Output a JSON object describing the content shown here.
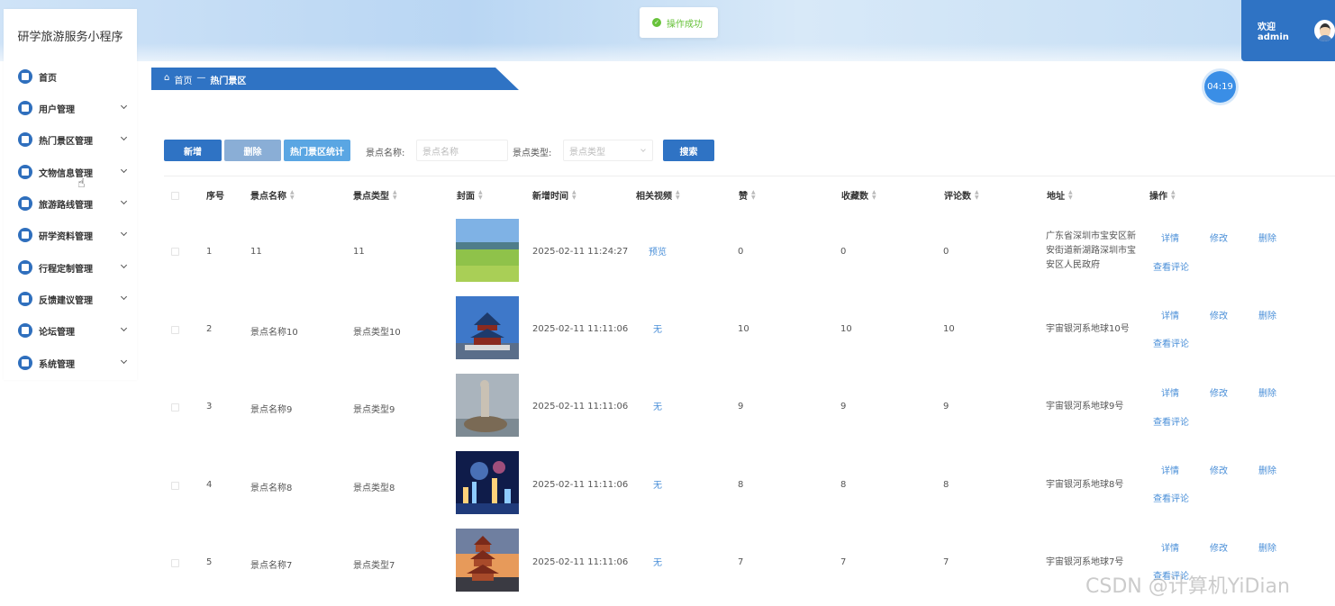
{
  "app": {
    "title": "研学旅游服务小程序"
  },
  "toast": {
    "message": "操作成功"
  },
  "user": {
    "welcome": "欢迎 admin"
  },
  "sidebar": {
    "items": [
      {
        "label": "首页",
        "icon": "home-icon"
      },
      {
        "label": "用户管理",
        "icon": "user-icon"
      },
      {
        "label": "热门景区管理",
        "icon": "square-icon"
      },
      {
        "label": "文物信息管理",
        "icon": "square-icon"
      },
      {
        "label": "旅游路线管理",
        "icon": "square-icon"
      },
      {
        "label": "研学资料管理",
        "icon": "gear-icon"
      },
      {
        "label": "行程定制管理",
        "icon": "square-icon"
      },
      {
        "label": "反馈建议管理",
        "icon": "folder-icon"
      },
      {
        "label": "论坛管理",
        "icon": "square-icon"
      },
      {
        "label": "系统管理",
        "icon": "square-icon"
      }
    ]
  },
  "breadcrumb": {
    "home": "首页",
    "separator": "—",
    "current": "热门景区"
  },
  "timer": "04:19",
  "toolbar": {
    "add": "新增",
    "delete": "删除",
    "stats": "热门景区统计",
    "name_label": "景点名称:",
    "name_placeholder": "景点名称",
    "type_label": "景点类型:",
    "type_placeholder": "景点类型",
    "search": "搜索"
  },
  "table": {
    "headers": [
      "序号",
      "景点名称",
      "景点类型",
      "封面",
      "新增时间",
      "相关视频",
      "赞",
      "收藏数",
      "评论数",
      "地址",
      "操作"
    ],
    "rows": [
      {
        "index": "1",
        "name": "11",
        "type": "11",
        "time": "2025-02-11 11:24:27",
        "video": "预览",
        "likes": "0",
        "favorites": "0",
        "comments": "0",
        "address": "广东省深圳市宝安区新安街道新湖路深圳市宝安区人民政府"
      },
      {
        "index": "2",
        "name": "景点名称10",
        "type": "景点类型10",
        "time": "2025-02-11 11:11:06",
        "video": "无",
        "likes": "10",
        "favorites": "10",
        "comments": "10",
        "address": "宇宙银河系地球10号"
      },
      {
        "index": "3",
        "name": "景点名称9",
        "type": "景点类型9",
        "time": "2025-02-11 11:11:06",
        "video": "无",
        "likes": "9",
        "favorites": "9",
        "comments": "9",
        "address": "宇宙银河系地球9号"
      },
      {
        "index": "4",
        "name": "景点名称8",
        "type": "景点类型8",
        "time": "2025-02-11 11:11:06",
        "video": "无",
        "likes": "8",
        "favorites": "8",
        "comments": "8",
        "address": "宇宙银河系地球8号"
      },
      {
        "index": "5",
        "name": "景点名称7",
        "type": "景点类型7",
        "time": "2025-02-11 11:11:06",
        "video": "无",
        "likes": "7",
        "favorites": "7",
        "comments": "7",
        "address": "宇宙银河系地球7号"
      }
    ],
    "actions": {
      "detail": "详情",
      "edit": "修改",
      "delete": "删除",
      "comments": "查看评论"
    }
  },
  "watermark": "CSDN @计算机YiDian",
  "colors": {
    "primary": "#2f73c4",
    "link": "#4a8fd8",
    "success": "#67c23a"
  }
}
